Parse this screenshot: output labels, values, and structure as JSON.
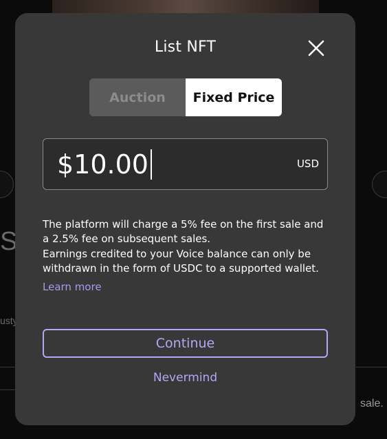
{
  "background": {
    "partial_text_left_large": "SS",
    "partial_text_left_small": "usty",
    "partial_text_right": "sale."
  },
  "modal": {
    "title": "List NFT",
    "close_icon": "close-icon",
    "tabs": [
      {
        "label": "Auction",
        "selected": false
      },
      {
        "label": "Fixed Price",
        "selected": true
      }
    ],
    "price": {
      "value": "$10.00",
      "currency": "USD"
    },
    "info_lines": [
      "The platform will charge a 5% fee on the first sale and a 2.5% fee on subsequent sales.",
      "Earnings credited to your Voice balance can only be withdrawn in the form of USDC to a supported wallet."
    ],
    "learn_more_label": "Learn more",
    "continue_label": "Continue",
    "nevermind_label": "Nevermind"
  },
  "colors": {
    "modal_background": "#383838",
    "accent": "#b4a7f5",
    "link": "#a999f0",
    "selected_tab": "#ffffff",
    "unselected_tab": "#5b5b5b"
  }
}
